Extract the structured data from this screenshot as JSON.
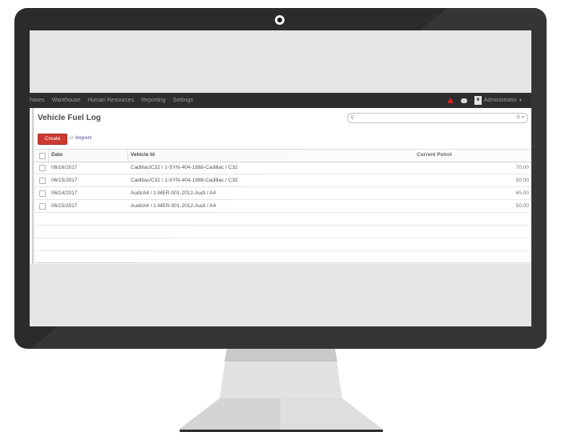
{
  "topbar": {
    "menu": [
      "hases",
      "Warehouse",
      "Human Resources",
      "Reporting",
      "Settings"
    ],
    "user": "Administrator"
  },
  "page": {
    "title": "Vehicle Fuel Log",
    "create_label": "Create",
    "or_label": "or",
    "import_label": "Import"
  },
  "table": {
    "columns": [
      "Date",
      "Vehicle Id",
      "Current Petrol"
    ],
    "rows": [
      {
        "date": "06/16/2017",
        "vehicle": "Cadillac/C32 / 1-SYN-404-1988-Cadillac / C32",
        "petrol": "70.00"
      },
      {
        "date": "06/15/2017",
        "vehicle": "Cadillac/C32 / 1-SYN-404-1988-Cadillac / C32",
        "petrol": "50.00"
      },
      {
        "date": "06/14/2017",
        "vehicle": "Audi/A4 / 1-MER-001-2012-Audi / A4",
        "petrol": "65.00"
      },
      {
        "date": "06/15/2017",
        "vehicle": "Audi/A4 / 1-MER-001-2012-Audi / A4",
        "petrol": "50.00"
      }
    ]
  },
  "colors": {
    "create_button": "#cc3b32",
    "topbar": "#2e2e2e",
    "import_link": "#7c7bad",
    "alert": "#e02020"
  },
  "icons": [
    "alert-icon",
    "chat-icon",
    "avatar",
    "search-icon",
    "search-options-icon",
    "caret-down-icon",
    "camera-icon"
  ]
}
